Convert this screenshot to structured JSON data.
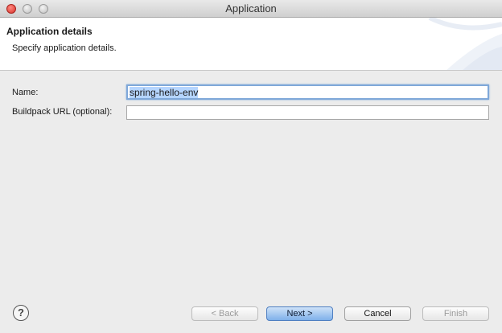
{
  "window": {
    "title": "Application"
  },
  "header": {
    "title": "Application details",
    "description": "Specify application details."
  },
  "form": {
    "name_label": "Name:",
    "name_value": "spring-hello-env",
    "buildpack_label": "Buildpack URL (optional):",
    "buildpack_value": ""
  },
  "buttons": {
    "help": "?",
    "back": "< Back",
    "next": "Next >",
    "cancel": "Cancel",
    "finish": "Finish"
  }
}
